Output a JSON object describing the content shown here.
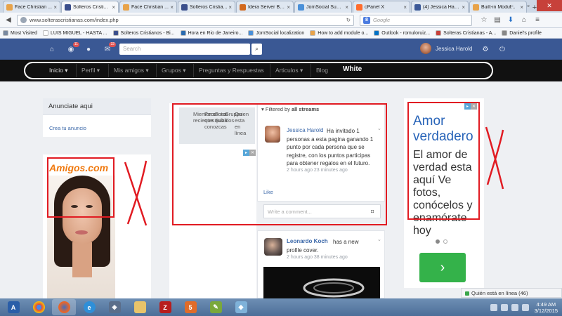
{
  "browser": {
    "tabs": [
      {
        "title": "Face Christian ...",
        "active": false,
        "favicon_color": "#e8a34a"
      },
      {
        "title": "Solteros Cristi...",
        "active": true,
        "favicon_color": "#3b4f8c"
      },
      {
        "title": "Face Christian ...",
        "active": false,
        "favicon_color": "#e8a34a"
      },
      {
        "title": "Solteros Cristia...",
        "active": false,
        "favicon_color": "#3b4f8c"
      },
      {
        "title": "Idera Server Ba...",
        "active": false,
        "favicon_color": "#d2691e"
      },
      {
        "title": "JomSocial Supp...",
        "active": false,
        "favicon_color": "#4a90d9"
      },
      {
        "title": "cPanel X",
        "active": false,
        "favicon_color": "#ff6c2c"
      },
      {
        "title": "(4) Jessica Haro...",
        "active": false,
        "favicon_color": "#3b5998"
      },
      {
        "title": "Built-in Modul...",
        "active": false,
        "favicon_color": "#e8a34a"
      }
    ],
    "url": "www.solterascristianas.com/index.php",
    "search_placeholder": "Google",
    "bookmarks": [
      {
        "label": "Most Visited",
        "color": "#7a8aa0"
      },
      {
        "label": "LUIS MIGUEL - HASTA ...",
        "color": "#ffffff"
      },
      {
        "label": "Solteros Cristianos - Bi...",
        "color": "#3b4f8c"
      },
      {
        "label": "Hora en Rio de Janeiro...",
        "color": "#2b6cb0"
      },
      {
        "label": "JomSocial localization",
        "color": "#4a90d9"
      },
      {
        "label": "How to add module o...",
        "color": "#e8a34a"
      },
      {
        "label": "Outlook - romuloruiz...",
        "color": "#0072c6"
      },
      {
        "label": "Solteras Cristianas - A...",
        "color": "#c7413a"
      },
      {
        "label": "Daniel's profile",
        "color": "#888888"
      }
    ]
  },
  "site": {
    "topbar": {
      "search_placeholder": "Search",
      "user_name": "Jessica Harold",
      "notif_badge": "11",
      "msg_badge": "32"
    },
    "menu": [
      {
        "label": "Inicio ▾"
      },
      {
        "label": "Perfil ▾"
      },
      {
        "label": "Mis amigos ▾"
      },
      {
        "label": "Grupos ▾"
      },
      {
        "label": "Preguntas y Respuestas"
      },
      {
        "label": "Articulos ▾"
      },
      {
        "label": "Blog"
      }
    ],
    "menu_annotation": "White",
    "ads_module": {
      "title": "Anunciate aqui",
      "link": "Crea tu anuncio"
    },
    "amigos_logo": "Amigos.com",
    "left_ad_cols": [
      "Miembros recientes",
      "Personas que quizá conozcas",
      "Fotos Subidos",
      "Grupos",
      "Quien esta en línea"
    ],
    "feed": {
      "filter_prefix": "Filtered by",
      "filter_value": "all streams",
      "post1": {
        "author": "Jessica Harold",
        "text": "Ha invitado 1 personas a esta pagina ganando 1 punto por cada persona que se registre, con los puntos participas para obtener regalos en el futuro.",
        "time": "2 hours ago 23 minutes ago",
        "like": "Like",
        "comment_placeholder": "Write a comment..."
      },
      "post2": {
        "author": "Leonardo Koch",
        "text": "has a new profile cover.",
        "time": "2 hours ago 38 minutes ago"
      }
    },
    "right_ad": {
      "title": "Amor verdadero",
      "body": "El amor de verdad esta aquí Ve fotos, conócelos y enamórate hoy"
    },
    "online_widget": "Quién está en línea (46)"
  },
  "taskbar": {
    "clock_time": "4:49 AM",
    "clock_date": "3/12/2015"
  },
  "colors": {
    "brand_blue": "#3a5894",
    "annotation_red": "#e11b22",
    "link_blue": "#3a67a8",
    "cta_green": "#34b24a"
  }
}
